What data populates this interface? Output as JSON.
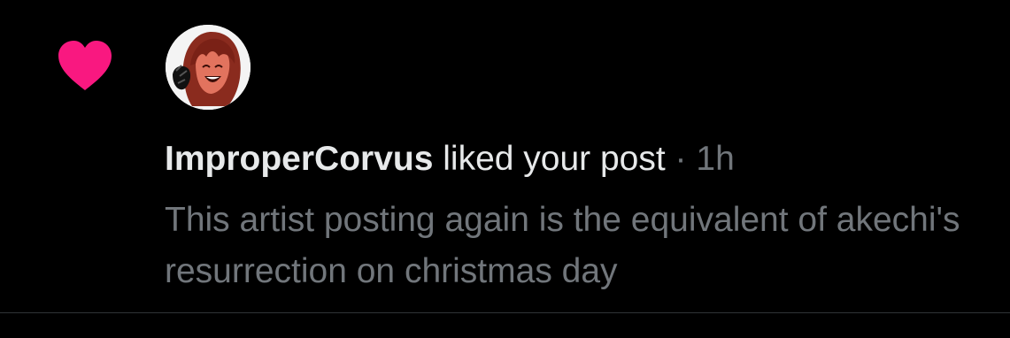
{
  "notification": {
    "type_icon": "heart-icon",
    "avatar_icon": "avatar",
    "username": "ImproperCorvus",
    "action": " liked your post",
    "separator": " · ",
    "time_ago": "1h",
    "post_preview": "This artist posting again is the equivalent of akechi's resurrection on christmas day"
  },
  "colors": {
    "background": "#000000",
    "heart": "#f91880",
    "primary_text": "#e7e9ea",
    "secondary_text": "#71767b",
    "divider": "#2f3336"
  }
}
